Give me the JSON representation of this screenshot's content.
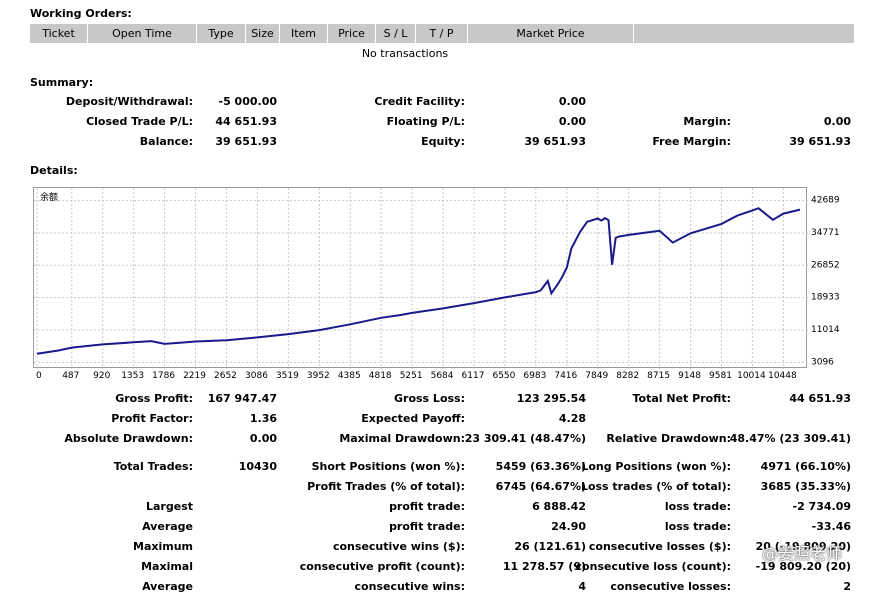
{
  "working_orders": {
    "title": "Working Orders:",
    "columns": [
      "Ticket",
      "Open Time",
      "Type",
      "Size",
      "Item",
      "Price",
      "S / L",
      "T / P",
      "Market Price",
      ""
    ],
    "empty_text": "No transactions"
  },
  "summary": {
    "title": "Summary:",
    "deposit_label": "Deposit/Withdrawal:",
    "deposit_value": "-5 000.00",
    "credit_label": "Credit Facility:",
    "credit_value": "0.00",
    "closed_pl_label": "Closed Trade P/L:",
    "closed_pl_value": "44 651.93",
    "floating_pl_label": "Floating P/L:",
    "floating_pl_value": "0.00",
    "margin_label": "Margin:",
    "margin_value": "0.00",
    "balance_label": "Balance:",
    "balance_value": "39 651.93",
    "equity_label": "Equity:",
    "equity_value": "39 651.93",
    "free_margin_label": "Free Margin:",
    "free_margin_value": "39 651.93"
  },
  "details": {
    "title": "Details:",
    "gross_profit_label": "Gross Profit:",
    "gross_profit_value": "167 947.47",
    "gross_loss_label": "Gross Loss:",
    "gross_loss_value": "123 295.54",
    "total_net_profit_label": "Total Net Profit:",
    "total_net_profit_value": "44 651.93",
    "profit_factor_label": "Profit Factor:",
    "profit_factor_value": "1.36",
    "expected_payoff_label": "Expected Payoff:",
    "expected_payoff_value": "4.28",
    "absolute_drawdown_label": "Absolute Drawdown:",
    "absolute_drawdown_value": "0.00",
    "maximal_drawdown_label": "Maximal Drawdown:",
    "maximal_drawdown_value": "23 309.41 (48.47%)",
    "relative_drawdown_label": "Relative Drawdown:",
    "relative_drawdown_value": "48.47% (23 309.41)",
    "total_trades_label": "Total Trades:",
    "total_trades_value": "10430",
    "short_positions_label": "Short Positions (won %):",
    "short_positions_value": "5459 (63.36%)",
    "long_positions_label": "Long Positions (won %):",
    "long_positions_value": "4971 (66.10%)",
    "profit_trades_label": "Profit Trades (% of total):",
    "profit_trades_value": "6745 (64.67%)",
    "loss_trades_label": "Loss trades (% of total):",
    "loss_trades_value": "3685 (35.33%)",
    "largest_label": "Largest",
    "largest_profit_label": "profit trade:",
    "largest_profit_value": "6 888.42",
    "largest_loss_label": "loss trade:",
    "largest_loss_value": "-2 734.09",
    "average_label": "Average",
    "average_profit_label": "profit trade:",
    "average_profit_value": "24.90",
    "average_loss_label": "loss trade:",
    "average_loss_value": "-33.46",
    "maximum_label": "Maximum",
    "max_consec_wins_label": "consecutive wins ($):",
    "max_consec_wins_value": "26 (121.61)",
    "max_consec_losses_label": "consecutive losses ($):",
    "max_consec_losses_value": "20 (-19 809.20)",
    "maximal_label": "Maximal",
    "maximal_consec_profit_label": "consecutive profit (count):",
    "maximal_consec_profit_value": "11 278.57 (9)",
    "maximal_consec_loss_label": "consecutive loss (count):",
    "maximal_consec_loss_value": "-19 809.20 (20)",
    "average2_label": "Average",
    "avg_consec_wins_label": "consecutive wins:",
    "avg_consec_wins_value": "4",
    "avg_consec_losses_label": "consecutive losses:",
    "avg_consec_losses_value": "2"
  },
  "watermark": "@姜照老师",
  "chart_data": {
    "type": "line",
    "title": "余额",
    "line_color": "#1a1a8c",
    "grid": true,
    "x_ticks": [
      0,
      487,
      920,
      1353,
      1786,
      2219,
      2652,
      3086,
      3519,
      3952,
      4385,
      4818,
      5251,
      5684,
      6117,
      6550,
      6983,
      7416,
      7849,
      8282,
      8715,
      9148,
      9581,
      10014,
      10448
    ],
    "y_ticks": [
      3096,
      11014,
      18933,
      26852,
      34771,
      42689
    ],
    "xlim": [
      0,
      10750
    ],
    "ylim": [
      2200,
      44800
    ],
    "series": [
      {
        "x": [
          0,
          150,
          300,
          487,
          700,
          920,
          1353,
          1600,
          1786,
          2000,
          2219,
          2652,
          2900,
          3086,
          3519,
          3952,
          4385,
          4818,
          5100,
          5251,
          5684,
          6117,
          6550,
          6983,
          7050,
          7150,
          7200,
          7300,
          7350,
          7416,
          7480,
          7600,
          7700,
          7849,
          7900,
          7950,
          8000,
          8050,
          8100,
          8150,
          8282,
          8715,
          8900,
          9148,
          9581,
          9800,
          10014,
          10100,
          10300,
          10448,
          10680
        ],
        "y": [
          5200,
          5600,
          6000,
          6700,
          7100,
          7500,
          8000,
          8300,
          7600,
          7900,
          8200,
          8500,
          8900,
          9200,
          10000,
          11000,
          12400,
          14000,
          14700,
          15200,
          16300,
          17600,
          19000,
          20300,
          20700,
          23000,
          20000,
          22500,
          24000,
          26300,
          31000,
          35000,
          37500,
          38300,
          37800,
          38400,
          37900,
          27000,
          33600,
          33900,
          34300,
          35300,
          32400,
          34700,
          37000,
          39000,
          40300,
          40800,
          38000,
          39500,
          40500
        ]
      }
    ]
  }
}
